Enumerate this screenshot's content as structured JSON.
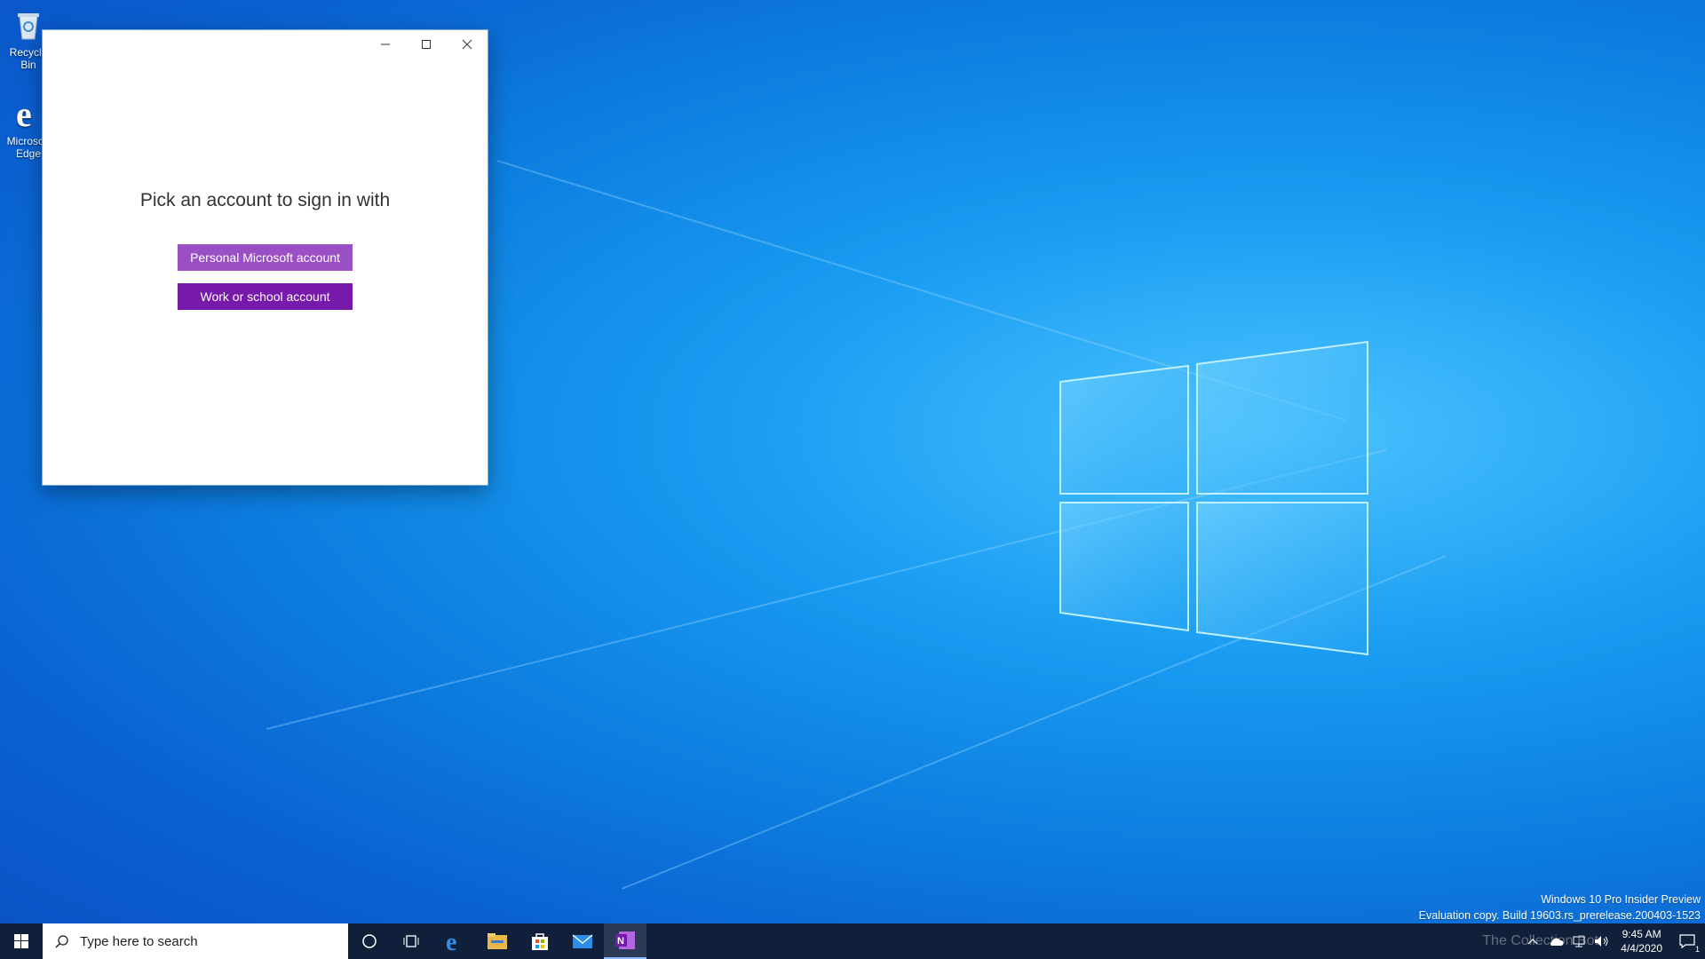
{
  "desktop": {
    "icons": [
      {
        "label": "Recycle Bin"
      },
      {
        "label": "Microsoft Edge"
      }
    ]
  },
  "dialog": {
    "title": "Pick an account to sign in with",
    "personal_label": "Personal Microsoft account",
    "work_label": "Work or school account",
    "colors": {
      "personal": "#9b4fc4",
      "work": "#7719aa"
    }
  },
  "watermark": {
    "line1": "Windows 10 Pro Insider Preview",
    "line2": "Evaluation copy. Build 19603.rs_prerelease.200403-1523"
  },
  "taskbar": {
    "search_placeholder": "Type here to search",
    "apps": [
      "cortana-icon",
      "task-view-icon",
      "edge-icon",
      "file-explorer-icon",
      "store-icon",
      "mail-icon",
      "onenote-icon"
    ],
    "time": "9:45 AM",
    "date": "4/4/2020",
    "notification_count": "1",
    "overlay_text": "The Collection Bot"
  }
}
